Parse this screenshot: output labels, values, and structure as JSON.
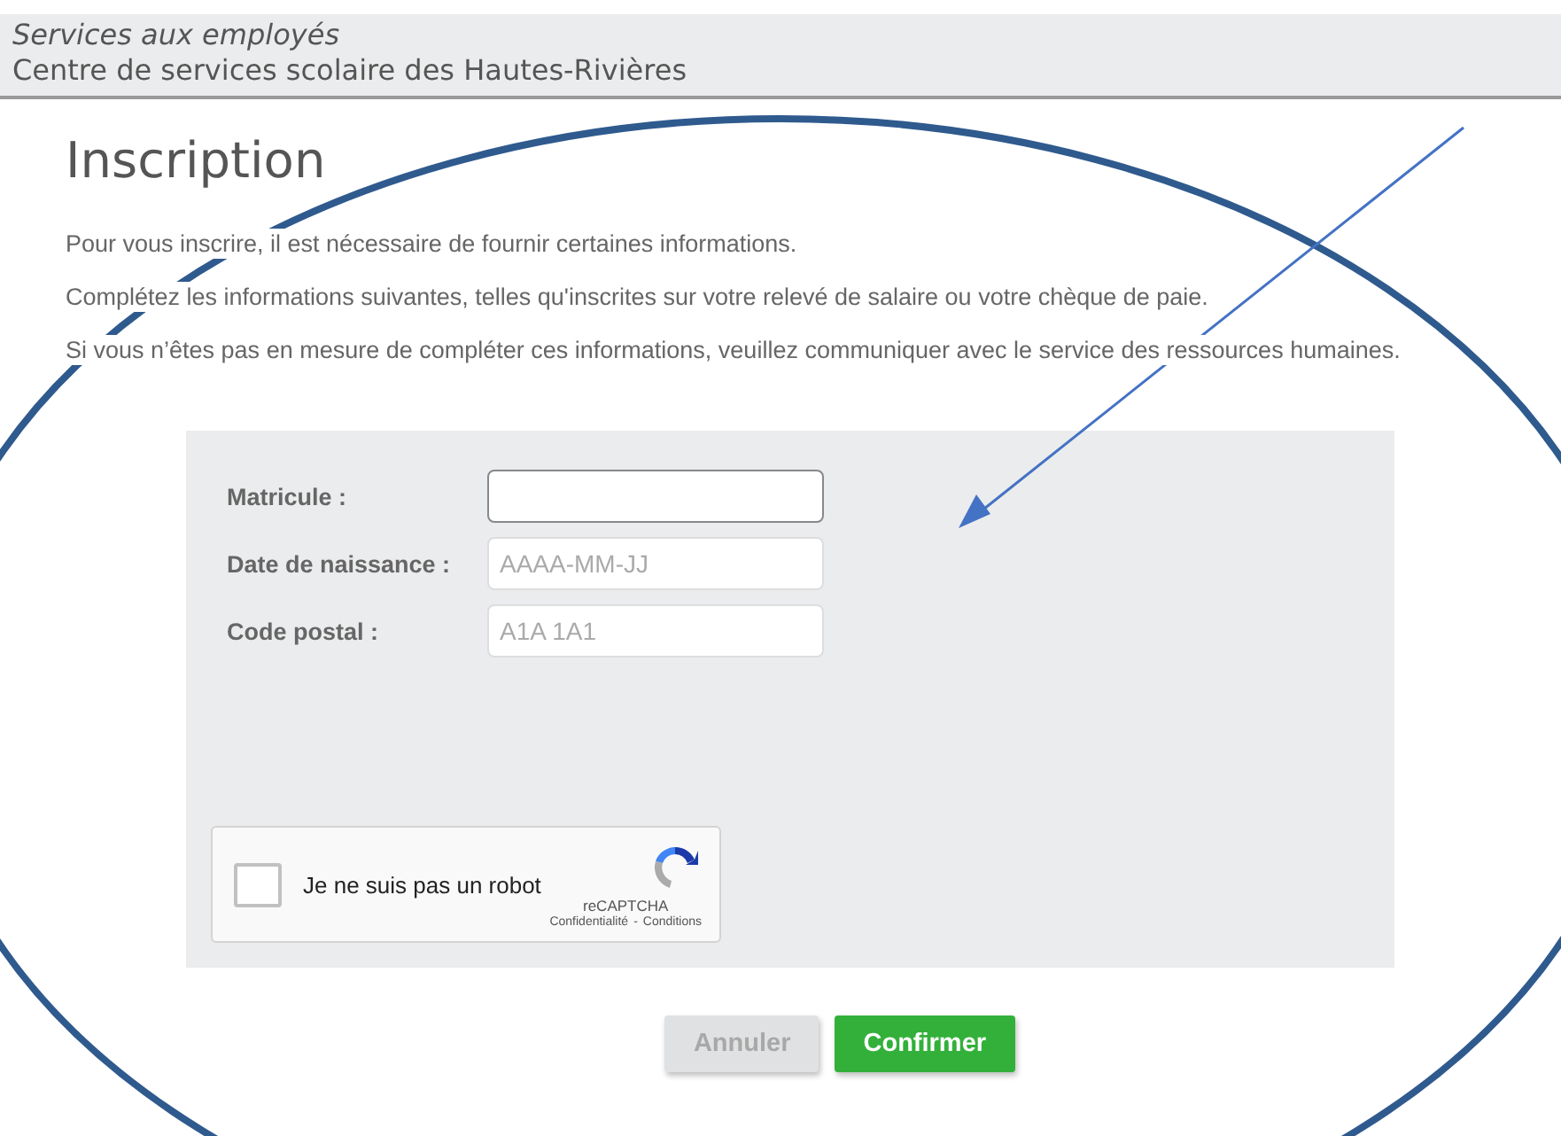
{
  "header": {
    "subtitle": "Services aux employés",
    "title": "Centre de services scolaire des Hautes-Rivières"
  },
  "page": {
    "heading": "Inscription",
    "paragraphs": [
      "Pour vous inscrire, il est nécessaire de fournir certaines informations.",
      "Complétez les informations suivantes, telles qu'inscrites sur votre relevé de salaire ou votre chèque de paie.",
      "Si vous n’êtes pas en mesure de compléter ces informations, veuillez communiquer avec le service des ressources humaines."
    ]
  },
  "form": {
    "fields": [
      {
        "label": "Matricule :",
        "focused": true
      },
      {
        "label": "Date de naissance :",
        "placeholder": "AAAA-MM-JJ",
        "focused": false
      },
      {
        "label": "Code postal :",
        "placeholder": "A1A 1A1",
        "focused": false
      }
    ],
    "captcha": {
      "label": "Je ne suis pas un robot",
      "checked": false,
      "brand": "reCAPTCHA",
      "links": [
        "Confidentialité",
        "Conditions"
      ],
      "separator": "-"
    }
  },
  "buttons": [
    {
      "label": "Annuler",
      "disabled": true
    },
    {
      "label": "Confirmer",
      "disabled": false
    }
  ]
}
